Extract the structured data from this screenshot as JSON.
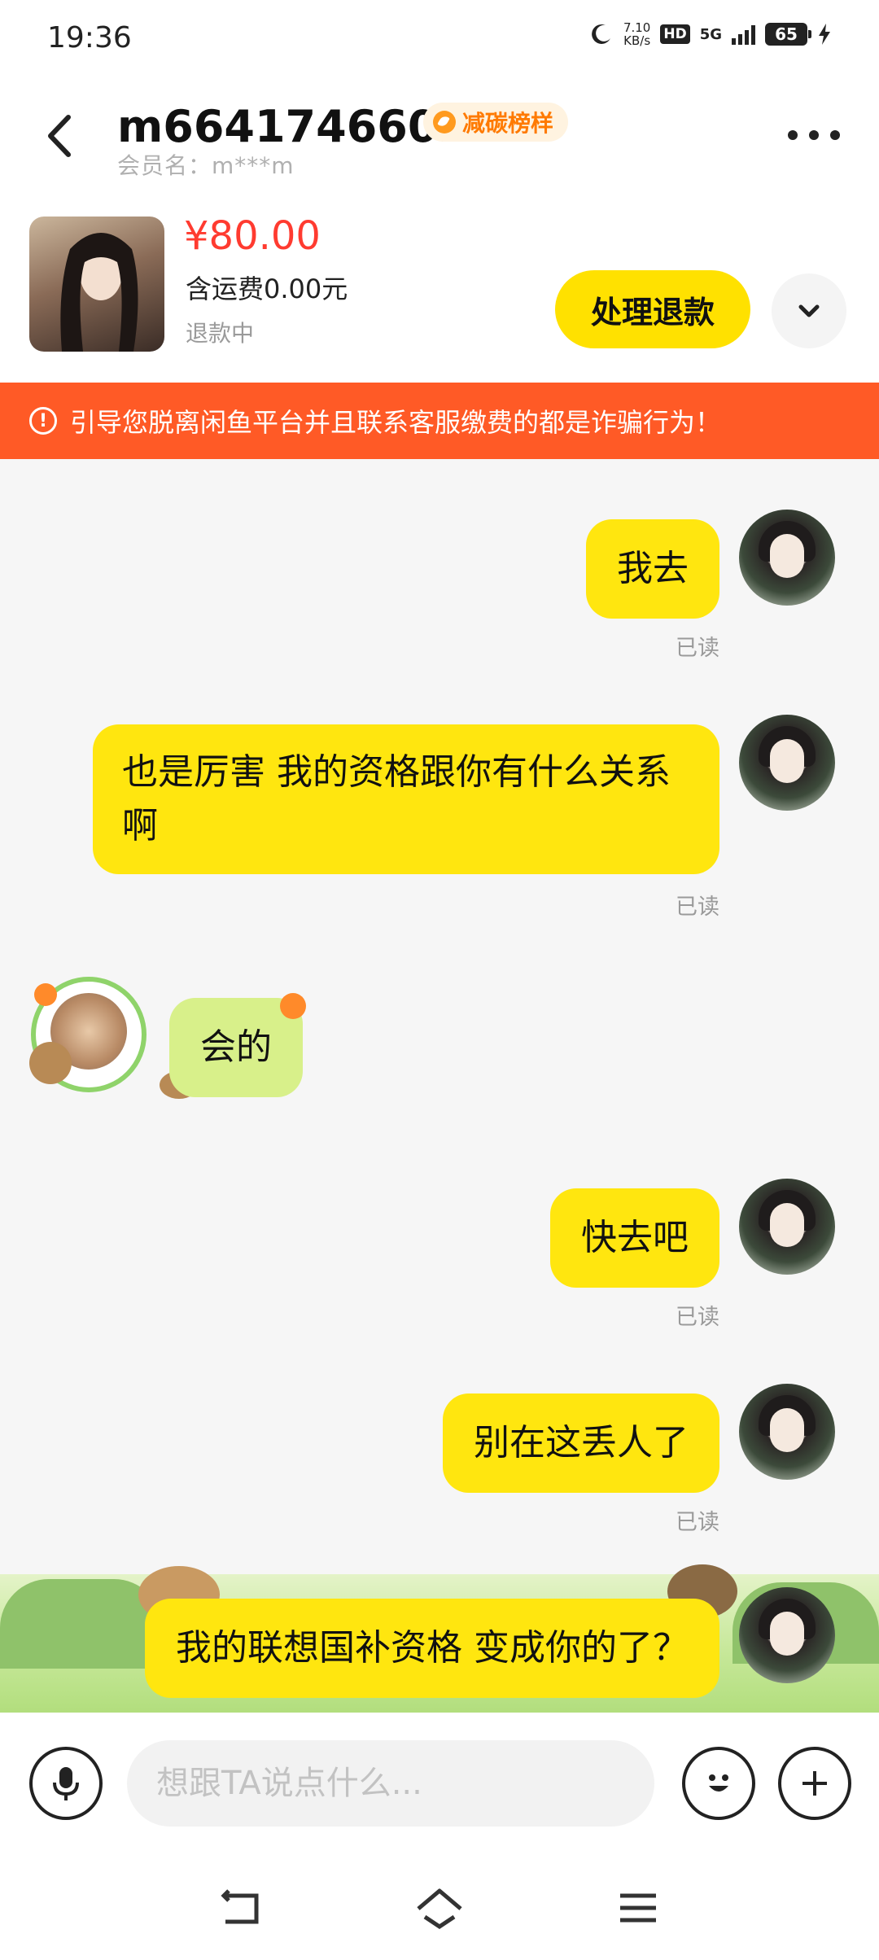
{
  "status_bar": {
    "time": "19:36",
    "net_speed_value": "7.10",
    "net_speed_unit": "KB/s",
    "hd_label": "HD",
    "network_label": "5G",
    "battery": "65"
  },
  "header": {
    "name": "m664174660m",
    "badge": "减碳榜样",
    "member": "会员名：m***m"
  },
  "product": {
    "price": "¥80.00",
    "shipping": "含运费0.00元",
    "status": "退款中",
    "refund_button": "处理退款"
  },
  "warning": {
    "text": "引导您脱离闲鱼平台并且联系客服缴费的都是诈骗行为！"
  },
  "messages": [
    {
      "side": "me",
      "text": "我去",
      "read": "已读"
    },
    {
      "side": "me",
      "text": "也是厉害 我的资格跟你有什么关系啊",
      "read": "已读"
    },
    {
      "side": "other",
      "text": "会的"
    },
    {
      "side": "me",
      "text": "快去吧",
      "read": "已读"
    },
    {
      "side": "me",
      "text": "别在这丢人了",
      "read": "已读"
    },
    {
      "side": "me",
      "text": "我的联想国补资格 变成你的了？"
    }
  ],
  "input": {
    "placeholder": "想跟TA说点什么..."
  },
  "colors": {
    "accent": "#ffe100",
    "my_bubble": "#ffe60f",
    "other_bubble": "#d8f08a",
    "warning": "#ff5a26",
    "price": "#ff3b30"
  },
  "icons": {
    "back": "chevron-left-icon",
    "more": "more-dots-icon",
    "expand": "chevron-down-icon",
    "warning": "alert-circle-icon",
    "voice": "microphone-icon",
    "emoji": "emoji-icon",
    "plus": "plus-icon",
    "nav_back": "nav-back-icon",
    "nav_home": "nav-home-icon",
    "nav_menu": "nav-menu-icon"
  }
}
